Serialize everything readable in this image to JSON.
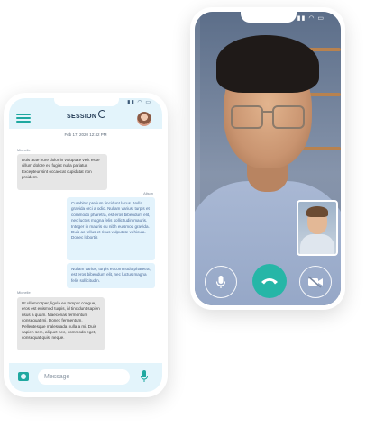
{
  "video_call": {
    "status_icons": "▮▮ ◠ ▭",
    "colors": {
      "end_call": "#26b6a7",
      "screen_tint": "#8e9ab0"
    },
    "controls": [
      "mic-icon",
      "end-call-icon",
      "video-camera-off-icon"
    ]
  },
  "chat": {
    "status_icons": "▮▮ ◠ ▭",
    "brand": "SESSION",
    "date": "Feb 17, 2020 12:42 PM",
    "messages": [
      {
        "sender": "Michelle",
        "direction": "in",
        "text": "Duis aute irure dolor in voluptate velit esse cillum dolore eu fugiat nulla pariatur. Excepteur sint occaecat cupidatat non proident."
      },
      {
        "sender": "Alison",
        "direction": "out",
        "text": "Curabitur pretium tincidunt lacus. Nulla gravida orci a odio. Nullam varius, turpis et commodo pharetra, est eros bibendum elit, nec luctus magna felis sollicitudin mauris. Integer in mauris eu nibh euismod gravida. Duis ac tellus et risus vulputate vehicula. Donec lobortis"
      },
      {
        "sender": "",
        "direction": "out",
        "text": "Nullam varius, turpis et commodo pharetra, est eros bibendum elit, nec luctus magna felis sollicitudin."
      },
      {
        "sender": "Michelle",
        "direction": "in",
        "text": "Ut ullamcorper, ligula eu tempor congue, eros est euismod turpis, id tincidunt sapien risus a quam. Maecenas fermentum consequat mi. Donec fermentum. Pellentesque malesuada nulla a mi. Duis sapien sem, aliquet nec, commodo eget, consequat quis, neque."
      }
    ],
    "composer": {
      "placeholder": "Message"
    },
    "colors": {
      "accent": "#1fa8a0",
      "header_bg": "#e3f4fb",
      "incoming": "#e6e6e6",
      "outgoing": "#e3f3fc"
    }
  }
}
